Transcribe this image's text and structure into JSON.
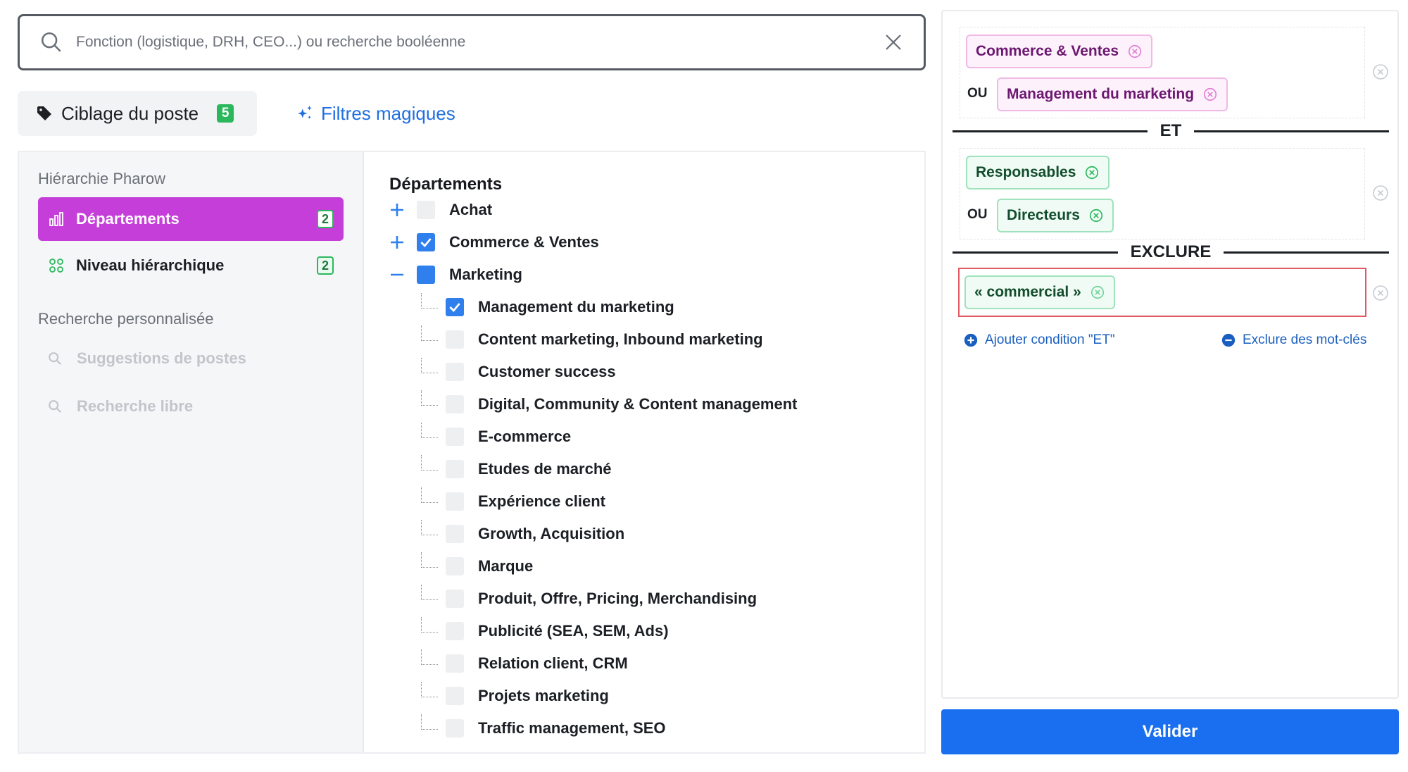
{
  "search": {
    "placeholder": "Fonction (logistique, DRH, CEO...) ou recherche booléenne",
    "value": ""
  },
  "tabs": {
    "ciblage_label": "Ciblage du poste",
    "ciblage_count": "5",
    "magic_label": "Filtres magiques"
  },
  "sidebar": {
    "section_hierarchy": "Hiérarchie Pharow",
    "items": [
      {
        "label": "Départements",
        "count": "2",
        "icon": "bar-chart-icon",
        "active": true
      },
      {
        "label": "Niveau hiérarchique",
        "count": "2",
        "icon": "grid-icon",
        "active": false
      }
    ],
    "section_custom": "Recherche personnalisée",
    "custom_items": [
      {
        "label": "Suggestions de postes",
        "icon": "search-icon"
      },
      {
        "label": "Recherche libre",
        "icon": "search-icon"
      }
    ]
  },
  "departments": {
    "title": "Départements",
    "roots": [
      {
        "label": "Achat",
        "state": "unchecked",
        "expander": "plus"
      },
      {
        "label": "Commerce & Ventes",
        "state": "checked",
        "expander": "plus"
      },
      {
        "label": "Marketing",
        "state": "partial",
        "expander": "minus"
      }
    ],
    "children": [
      {
        "label": "Management du marketing",
        "checked": true
      },
      {
        "label": "Content marketing, Inbound marketing",
        "checked": false
      },
      {
        "label": "Customer success",
        "checked": false
      },
      {
        "label": "Digital, Community & Content management",
        "checked": false
      },
      {
        "label": "E-commerce",
        "checked": false
      },
      {
        "label": "Etudes de marché",
        "checked": false
      },
      {
        "label": "Expérience client",
        "checked": false
      },
      {
        "label": "Growth, Acquisition",
        "checked": false
      },
      {
        "label": "Marque",
        "checked": false
      },
      {
        "label": "Produit, Offre, Pricing, Merchandising",
        "checked": false
      },
      {
        "label": "Publicité (SEA, SEM, Ads)",
        "checked": false
      },
      {
        "label": "Relation client, CRM",
        "checked": false
      },
      {
        "label": "Projets marketing",
        "checked": false
      },
      {
        "label": "Traffic management, SEO",
        "checked": false
      }
    ]
  },
  "conditions": {
    "group1": {
      "chip1": "Commerce & Ventes",
      "or_label": "OU",
      "chip2": "Management du marketing"
    },
    "and_label": "ET",
    "group2": {
      "chip1": "Responsables",
      "or_label": "OU",
      "chip2": "Directeurs"
    },
    "exclude_label": "EXCLURE",
    "exclude_chip": "« commercial »",
    "add_and": "Ajouter condition \"ET\"",
    "exclude_keywords": "Exclure des mot-clés"
  },
  "validate_label": "Valider",
  "colors": {
    "accent_active": "#c63ed9",
    "primary_blue": "#1a6ff0",
    "count_green": "#2bb85c",
    "exclude_red": "#e05a63"
  }
}
